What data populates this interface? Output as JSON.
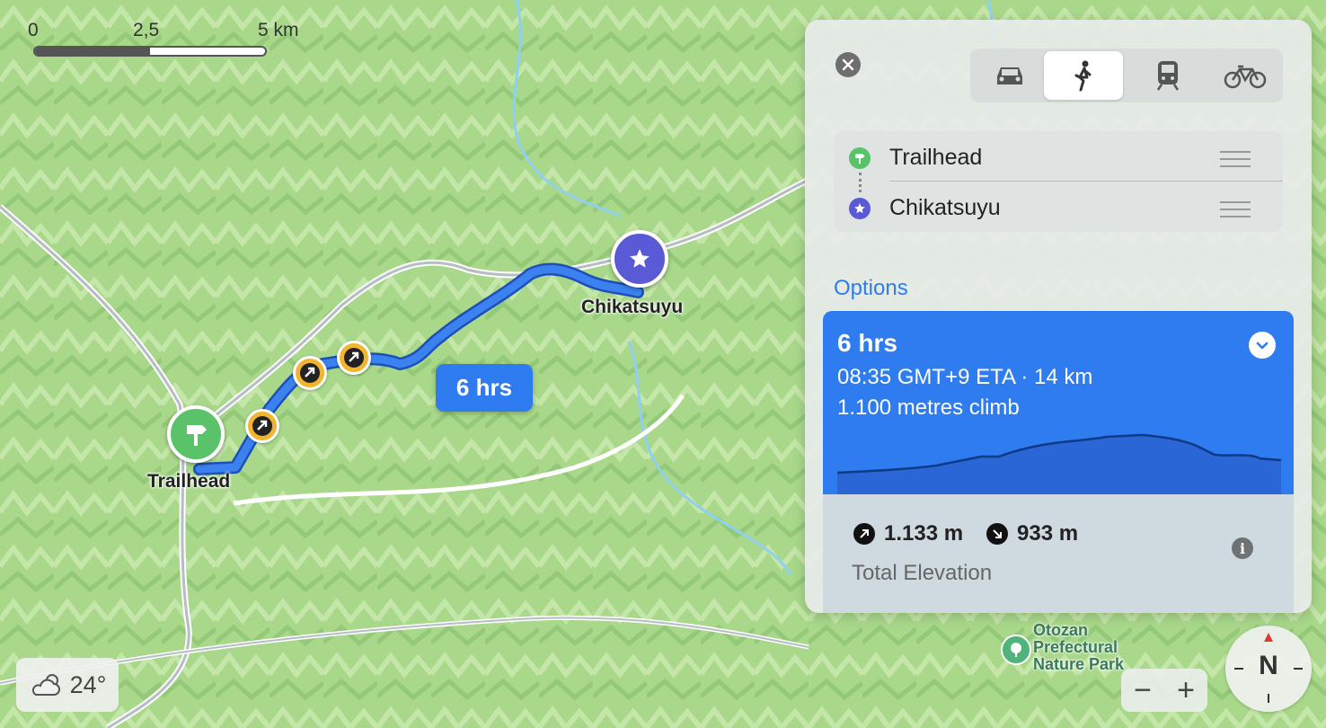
{
  "map": {
    "scale": {
      "zero": "0",
      "half": "2,5",
      "full": "5 km"
    },
    "start_label": "Trailhead",
    "end_label": "Chikatsuyu",
    "route_eta": "6 hrs",
    "poi_line1": "Otozan",
    "poi_line2": "Prefectural",
    "poi_line3": "Nature Park",
    "weather_temp": "24°",
    "compass_label": "N",
    "zoom_out": "−",
    "zoom_in": "+"
  },
  "panel": {
    "modes": [
      "car-icon",
      "walk-icon",
      "transit-icon",
      "bike-icon"
    ],
    "active_mode": "walk",
    "waypoints": [
      {
        "label": "Trailhead",
        "icon": "signpost-icon",
        "color": "#5ac36a"
      },
      {
        "label": "Chikatsuyu",
        "icon": "star-icon",
        "color": "#5a5ad6"
      }
    ],
    "options_label": "Options",
    "route": {
      "duration": "6 hrs",
      "eta_distance": "08:35 GMT+9 ETA · 14 km",
      "climb": "1.100 metres climb"
    },
    "elevation": {
      "ascent": "1.133 m",
      "descent": "933 m",
      "caption": "Total Elevation"
    }
  },
  "colors": {
    "accent": "#2f7bf0",
    "terrain": "#a9d88a",
    "route": "#2f6fe0",
    "step": "#f3b530"
  }
}
